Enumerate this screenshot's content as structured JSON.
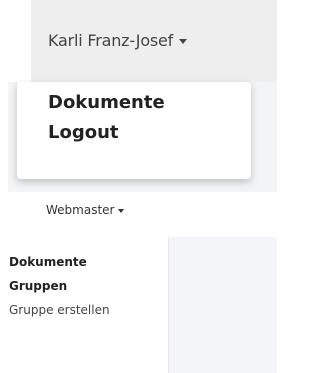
{
  "user_menu": {
    "name": "Karli Franz-Josef",
    "items": [
      {
        "label": "Dokumente"
      },
      {
        "label": "Logout"
      }
    ]
  },
  "webmaster_menu": {
    "name": "Webmaster",
    "items": [
      {
        "label": "Dokumente"
      },
      {
        "label": "Gruppen"
      },
      {
        "label": "Gruppe erstellen"
      }
    ]
  },
  "icons": {
    "dropdown": "caret-down-icon"
  },
  "colors": {
    "toggle_bg": "#eeeeee",
    "menu_bg": "#ffffff",
    "page_bg": "#f3f5f8",
    "text": "#222222"
  }
}
